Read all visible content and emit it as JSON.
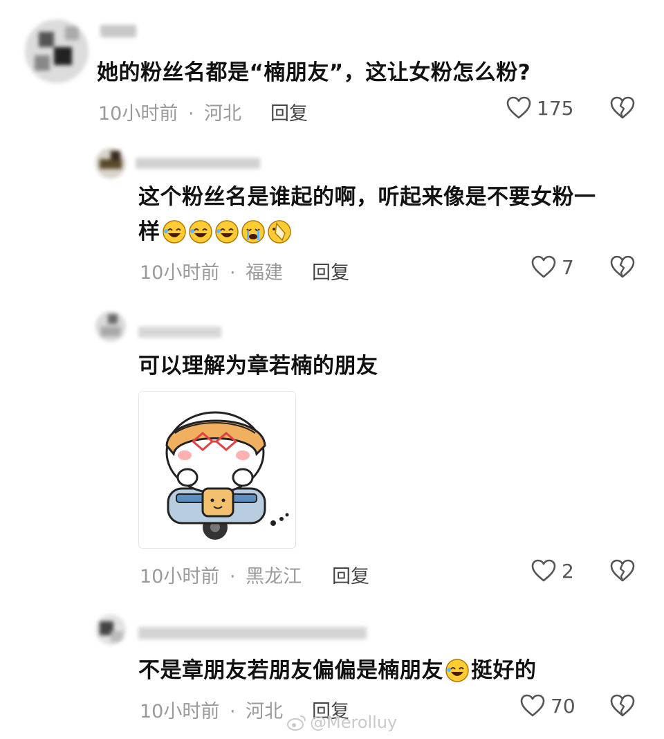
{
  "comments": [
    {
      "text": "她的粉丝名都是“楠朋友”，这让女粉怎么粉?",
      "time": "10小时前",
      "sep": "·",
      "location": "河北",
      "reply": "回复",
      "likes": "175"
    },
    {
      "text_line1": "这个粉丝名是谁起的啊，听起来像是不要女粉一",
      "text_line2": "样",
      "time": "10小时前",
      "sep": "·",
      "location": "福建",
      "reply": "回复",
      "likes": "7"
    },
    {
      "text": "可以理解为章若楠的朋友",
      "time": "10小时前",
      "sep": "·",
      "location": "黑龙江",
      "reply": "回复",
      "likes": "2"
    },
    {
      "text_before": "不是章朋友若朋友偏偏是楠朋友",
      "text_after": "挺好的",
      "time": "10小时前",
      "sep": "·",
      "location": "河北",
      "reply": "回复",
      "likes": "70"
    }
  ],
  "watermark": "@Merolluy",
  "icons": {
    "like": "heart-outline-icon",
    "dislike": "broken-heart-icon",
    "emoji": "laughing-face-emoji"
  },
  "colors": {
    "text": "#111111",
    "meta": "#9a9a9a",
    "icon": "#555555"
  }
}
